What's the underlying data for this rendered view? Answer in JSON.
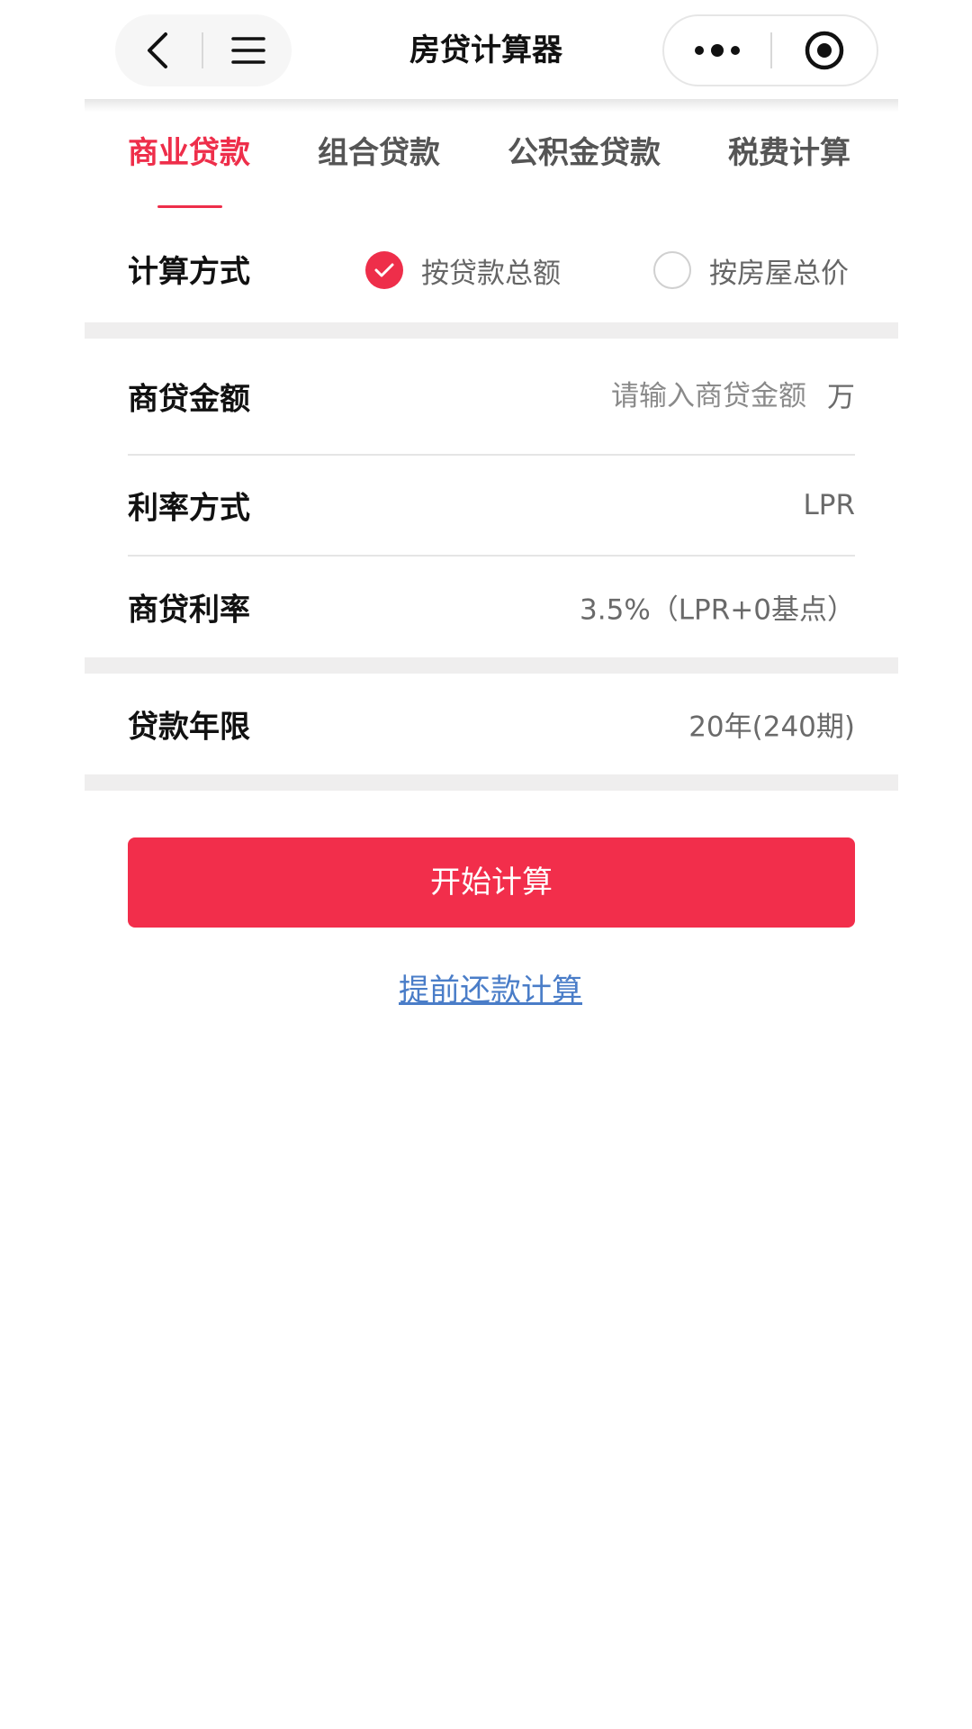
{
  "navbar": {
    "title": "房贷计算器"
  },
  "tabs": [
    {
      "label": "商业贷款",
      "active": true
    },
    {
      "label": "组合贷款",
      "active": false
    },
    {
      "label": "公积金贷款",
      "active": false
    },
    {
      "label": "税费计算",
      "active": false
    }
  ],
  "method": {
    "label": "计算方式",
    "options": [
      {
        "label": "按贷款总额",
        "checked": true
      },
      {
        "label": "按房屋总价",
        "checked": false
      }
    ]
  },
  "form": {
    "amount": {
      "label": "商贷金额",
      "placeholder": "请输入商贷金额",
      "value": "",
      "unit": "万"
    },
    "rate_mode": {
      "label": "利率方式",
      "value": "LPR"
    },
    "rate": {
      "label": "商贷利率",
      "value": "3.5%（LPR+0基点）"
    },
    "term": {
      "label": "贷款年限",
      "value": "20年(240期)"
    }
  },
  "actions": {
    "calculate_label": "开始计算",
    "prepay_label": "提前还款计算"
  },
  "colors": {
    "accent": "#f22e4b",
    "link": "#4a7dc8",
    "band": "#efeeee"
  }
}
